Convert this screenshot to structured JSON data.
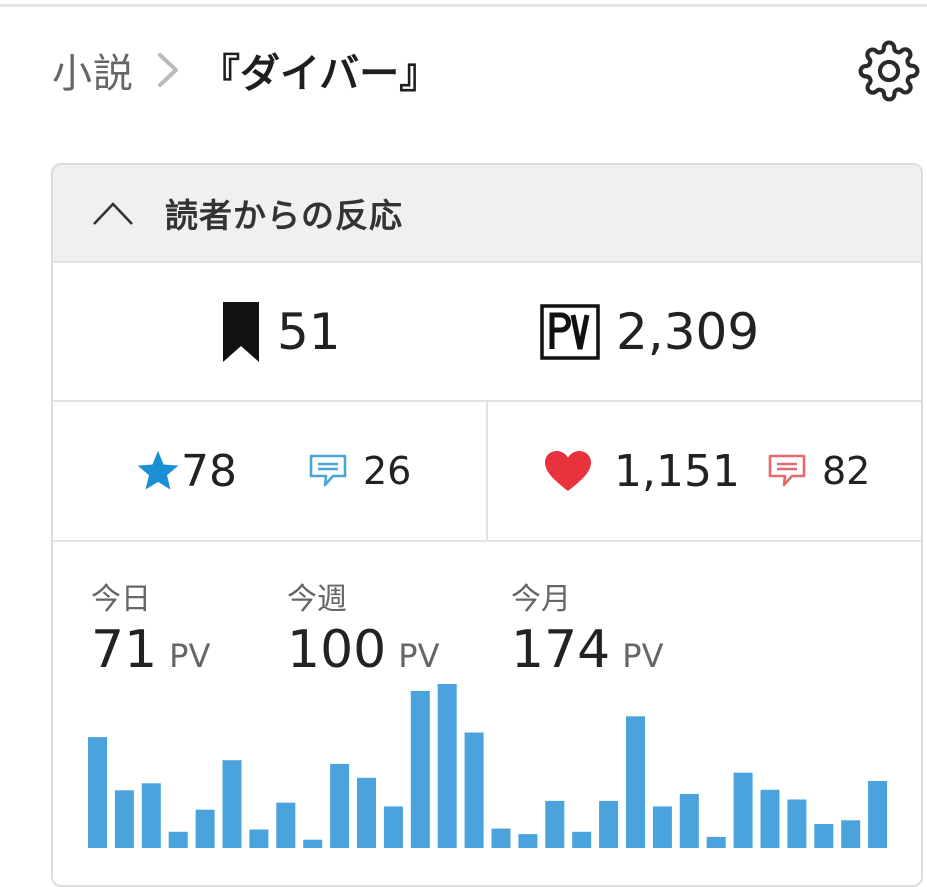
{
  "breadcrumb": {
    "parent": "小説",
    "current": "『ダイバー』"
  },
  "icons": {
    "settings": "gear-icon",
    "collapse": "chevron-up-icon",
    "bookmark": "bookmark-icon",
    "pv": "pv-icon",
    "star": "star-icon",
    "comment": "comment-icon",
    "heart": "heart-icon"
  },
  "colors": {
    "star_blue": "#1a8fd4",
    "comment_blue": "#4aa6d6",
    "heart_red": "#e8333c",
    "comment_red": "#e8696b",
    "bar_blue": "#4aa3dc"
  },
  "panel": {
    "title": "読者からの反応",
    "bookmarks": "51",
    "pv_total": "2,309",
    "stars": "78",
    "star_comments": "26",
    "likes": "1,151",
    "like_comments": "82"
  },
  "pv_stats": {
    "today_label": "今日",
    "today_value": "71",
    "week_label": "今週",
    "week_value": "100",
    "month_label": "今月",
    "month_value": "174",
    "unit": "PV"
  },
  "chart_data": {
    "type": "bar",
    "values": [
      24,
      12.5,
      14,
      3.5,
      8.3,
      19,
      4,
      9.8,
      1.8,
      18.2,
      15.2,
      9,
      34,
      35.5,
      25,
      4.2,
      3,
      10.2,
      3.5,
      10.2,
      28.5,
      9,
      11.7,
      2.4,
      16.3,
      12.6,
      10.5,
      5.2,
      6,
      14.5
    ]
  }
}
